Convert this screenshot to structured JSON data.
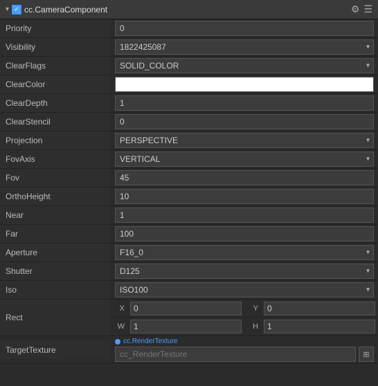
{
  "header": {
    "title": "cc.CameraComponent",
    "checkbox_checked": true,
    "settings_icon": "⚙",
    "menu_icon": "☰"
  },
  "props": [
    {
      "id": "priority",
      "label": "Priority",
      "type": "text",
      "value": "0"
    },
    {
      "id": "visibility",
      "label": "Visibility",
      "type": "select",
      "value": "1822425087"
    },
    {
      "id": "clearflags",
      "label": "ClearFlags",
      "type": "select",
      "value": "SOLID_COLOR"
    },
    {
      "id": "clearcolor",
      "label": "ClearColor",
      "type": "color",
      "value": "#ffffff"
    },
    {
      "id": "cleardepth",
      "label": "ClearDepth",
      "type": "text",
      "value": "1"
    },
    {
      "id": "clearstencil",
      "label": "ClearStencil",
      "type": "text",
      "value": "0"
    },
    {
      "id": "projection",
      "label": "Projection",
      "type": "select",
      "value": "PERSPECTIVE"
    },
    {
      "id": "fovaxis",
      "label": "FovAxis",
      "type": "select",
      "value": "VERTICAL"
    },
    {
      "id": "fov",
      "label": "Fov",
      "type": "text",
      "value": "45"
    },
    {
      "id": "orthoheight",
      "label": "OrthoHeight",
      "type": "text",
      "value": "10"
    },
    {
      "id": "near",
      "label": "Near",
      "type": "text",
      "value": "1"
    },
    {
      "id": "far",
      "label": "Far",
      "type": "text",
      "value": "100"
    },
    {
      "id": "aperture",
      "label": "Aperture",
      "type": "select",
      "value": "F16_0"
    },
    {
      "id": "shutter",
      "label": "Shutter",
      "type": "select",
      "value": "D125"
    },
    {
      "id": "iso",
      "label": "Iso",
      "type": "select",
      "value": "ISO100"
    }
  ],
  "rect": {
    "label": "Rect",
    "x_label": "X",
    "y_label": "Y",
    "w_label": "W",
    "h_label": "H",
    "x_value": "0",
    "y_value": "0",
    "w_value": "1",
    "h_value": "1"
  },
  "target_texture": {
    "label": "TargetTexture",
    "hint": "cc.RenderTexture",
    "placeholder": "cc_RenderTexture",
    "pick_icon": "⊞"
  }
}
